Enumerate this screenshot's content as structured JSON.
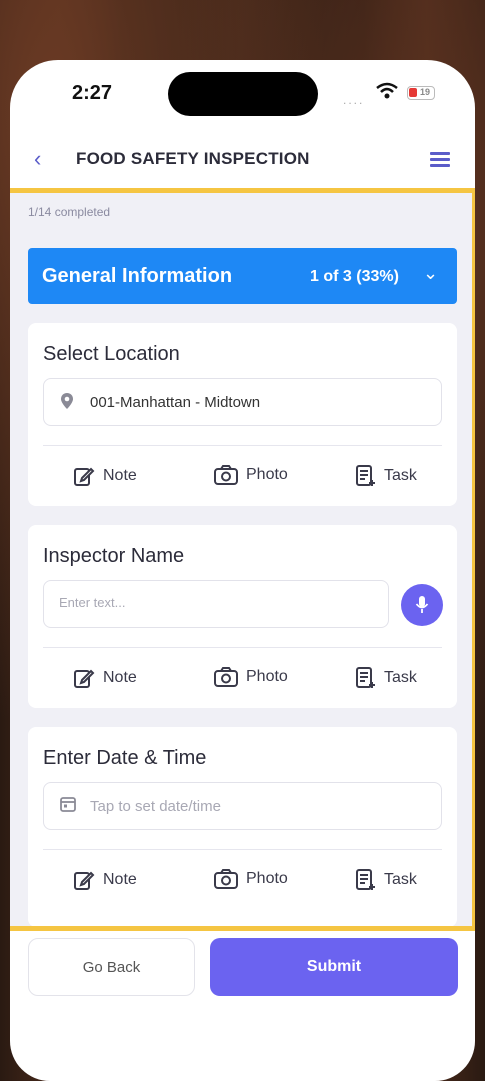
{
  "status_bar": {
    "time": "2:27",
    "signal": "....",
    "battery": "19"
  },
  "header": {
    "title": "FOOD SAFETY INSPECTION"
  },
  "progress_text": "1/14 completed",
  "section": {
    "title": "General Information",
    "progress": "1 of 3 (33%)"
  },
  "cards": [
    {
      "label": "Select Location",
      "value": "001-Manhattan - Midtown"
    },
    {
      "label": "Inspector Name",
      "placeholder": "Enter text..."
    },
    {
      "label": "Enter Date & Time",
      "placeholder": "Tap to set date/time"
    }
  ],
  "actions": {
    "note": "Note",
    "photo": "Photo",
    "task": "Task"
  },
  "footer": {
    "back_label": "Go Back",
    "submit_label": "Submit"
  },
  "colors": {
    "accent": "#1e88f5",
    "primary": "#6b63f0",
    "highlight_frame": "#f5c542"
  }
}
